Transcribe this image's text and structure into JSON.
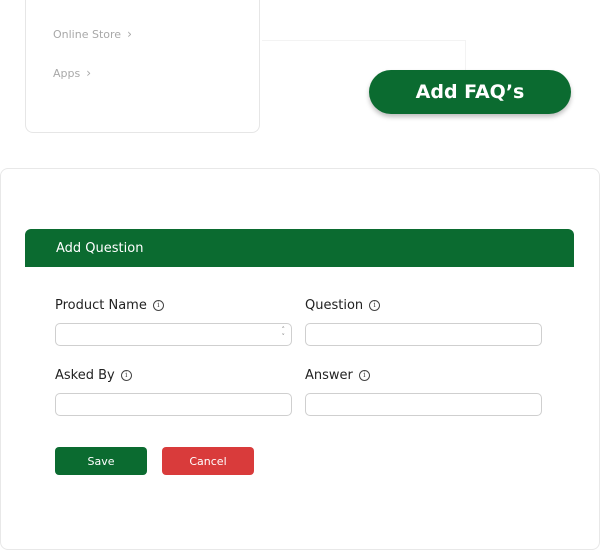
{
  "nav": {
    "items": [
      {
        "label": "Online Store"
      },
      {
        "label": "Apps"
      }
    ]
  },
  "actions": {
    "add_faq_label": "Add FAQ’s"
  },
  "form": {
    "title": "Add Question",
    "fields": {
      "product_name": {
        "label": "Product Name",
        "value": ""
      },
      "question": {
        "label": "Question",
        "value": ""
      },
      "asked_by": {
        "label": "Asked By",
        "value": ""
      },
      "answer": {
        "label": "Answer",
        "value": ""
      }
    },
    "save_label": "Save",
    "cancel_label": "Cancel"
  },
  "colors": {
    "primary": "#0b6b30",
    "danger": "#d93b3b"
  }
}
